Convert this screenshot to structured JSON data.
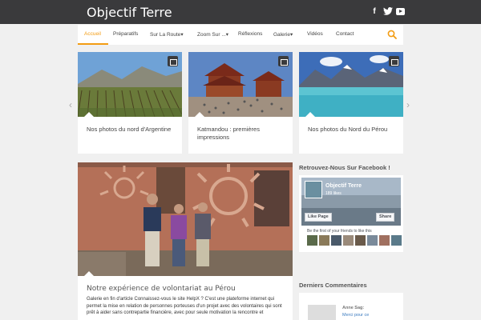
{
  "header": {
    "site_title": "Objectif Terre",
    "social": [
      {
        "label": "f",
        "icon": "facebook-icon"
      },
      {
        "label": "",
        "icon": "twitter-icon"
      },
      {
        "label": "",
        "icon": "youtube-icon"
      }
    ]
  },
  "nav": {
    "items": [
      {
        "label": "Accueil"
      },
      {
        "label": "Préparatifs"
      },
      {
        "label": "Sur La Route",
        "chevron": "▾"
      },
      {
        "label": "Zoom Sur ...",
        "chevron": "▾"
      },
      {
        "label": "Réflexions"
      },
      {
        "label": "Galerie",
        "chevron": "▾"
      },
      {
        "label": "Vidéos"
      },
      {
        "label": "Contact"
      }
    ],
    "accent": "#f39c12"
  },
  "slider": {
    "prev": "‹",
    "next": "›",
    "cards": [
      {
        "title": "Nos photos du nord d'Argentine",
        "icon": "calendar-icon"
      },
      {
        "title": "Katmandou : premières impressions",
        "icon": "calendar-icon"
      },
      {
        "title": "Nos photos du Nord du Pérou",
        "icon": "calendar-icon"
      }
    ]
  },
  "featured": {
    "title": "Notre expérience de volontariat au Pérou",
    "excerpt": "Galerie en fin d'article Connaissez-vous le site HelpX ? C'est une plateforme internet qui permet la mise en relation de personnes porteuses d'un projet avec des volontaires qui sont prêt à aider sans contrepartie financière, avec pour seule motivation la rencontre et"
  },
  "sidebar": {
    "facebook_heading": "Retrouvez-Nous Sur Facebook !",
    "fb_page_name": "Objectif Terre",
    "fb_likes": "189 likes",
    "fb_like_button": "Like Page",
    "fb_share_button": "Share",
    "fb_friends_text": "Be the first of your friends to like this",
    "comments_heading": "Derniers Commentaires",
    "comment_author": "Anne Sag:",
    "comment_text": "Merci pour ce"
  }
}
